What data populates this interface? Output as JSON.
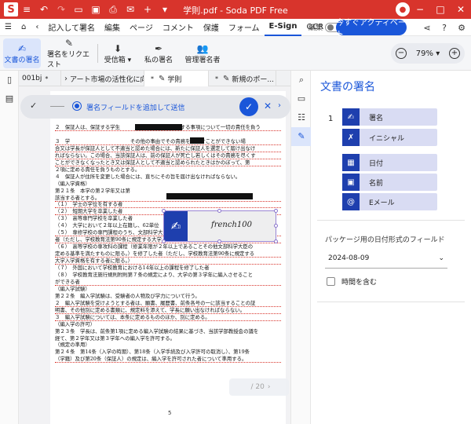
{
  "app": {
    "file_title": "学則.pdf",
    "app_name": "Soda PDF Free",
    "title_sep": "-"
  },
  "menu": {
    "items": [
      "記入して署名",
      "編集",
      "ページ",
      "コメント",
      "保護",
      "フォーム",
      "E-Sign",
      "OCR"
    ],
    "active": "E-Sign",
    "edit_toggle_label": "編集",
    "activate_label": "今すぐアクティベート"
  },
  "ribbon": {
    "buttons": [
      "文書の署名",
      "署名をリクエスト",
      "受信箱",
      "私の署名",
      "管理署名者"
    ],
    "zoom": "79%"
  },
  "tabs": [
    {
      "label": "001bj",
      "icon": "file-icon",
      "modified": true
    },
    {
      "label": "アート市場の活性化に向けて",
      "icon": "file-icon",
      "modified": true
    },
    {
      "label": "学則",
      "icon": "pen-icon",
      "modified": true
    },
    {
      "label": "新規のポー...",
      "icon": "pen-icon",
      "modified": false
    }
  ],
  "signbar": {
    "status": "署名フィールドを追加して送信"
  },
  "signature_field": {
    "signer_name": "french100"
  },
  "document": {
    "lines": [
      {
        "text": "２　保証人は、保証する学生　　　　　　　　　務に関する事項について一切の責任を負う",
        "u": true
      },
      {
        "text": "",
        "u": false
      },
      {
        "text": "３　学　　　　　　　　　　　　その他の事由でその責務を尽くすことができない場",
        "u": true
      },
      {
        "text": "合又は学長が保証人として不適当と認めた場合には、新たに保証人を選定して届け出なけ",
        "u": true
      },
      {
        "text": "ればならない。この場合、当該保証人は、前の保証人が死亡し若しくはその責務を尽くす",
        "u": true
      },
      {
        "text": "ことができなくなったとき又は保証人として不適当と認められたときはかのぼって、第",
        "u": true
      },
      {
        "text": "２項に定める責任を負うものとする。",
        "u": false
      },
      {
        "text": "４　保証人が住所を変更した場合には、直ちにその旨を届け出なければならない。",
        "u": false
      },
      {
        "text": "（編入学資格）",
        "u": false
      },
      {
        "text": "第２１条　本学の第２学年又は第",
        "u": false
      },
      {
        "text": "該当する者とする。",
        "u": true
      },
      {
        "text": "（１）　学士の学位を有する者",
        "u": true
      },
      {
        "text": "（２）　短期大学を卒業した者",
        "u": true
      },
      {
        "text": "（３）　高等専門学校を卒業した者",
        "u": false
      },
      {
        "text": "（４）　大学において２年以上在籍し、62単位",
        "u": false
      },
      {
        "text": "（５）　専修学校の専門課程のうち、文部科学大臣の定める基準を満たすものを修了した",
        "u": true
      },
      {
        "text": "者（ただし、学校教育法第90条に規定する大学入学資格を有する者に限る。）",
        "u": true
      },
      {
        "text": "（６）　高等学校の専攻科の課程（修業年限が２年以上であることその他文部科学大臣の",
        "u": false
      },
      {
        "text": "定める基準を満たすものに限る。）を修了した者（ただし、学校教育法第90条に規定する",
        "u": true
      },
      {
        "text": "大学入学資格を有する者に限る。）",
        "u": true
      },
      {
        "text": "（７）　外国において学校教育における14年以上の課程を修了した者",
        "u": false
      },
      {
        "text": "（８）　学校教育法施行規則附則第７条の規定により、大学の第３学年に編入させること",
        "u": false
      },
      {
        "text": "ができる者",
        "u": true
      },
      {
        "text": "（編入学試験）",
        "u": false
      },
      {
        "text": "第２２条　編入学試験は、受験者の人物及び学力について行う。",
        "u": false
      },
      {
        "text": "２　編入学試験を受けようとする者は、願書、履歴書、前条各号の一に該当することの証",
        "u": true
      },
      {
        "text": "明書、その他別に定める書類に、規定料を添えて、学長に願い出なければならない。",
        "u": true
      },
      {
        "text": "３　編入学試験については、本条に定めるもののほか、別に定める。",
        "u": true
      },
      {
        "text": "（編入学の許可）",
        "u": false
      },
      {
        "text": "第２３条　学長は、前条第1項に定める編入学試験の結果に基づき、当該学部教授会の議を",
        "u": false
      },
      {
        "text": "経て、第２学年又は第３学年への編入学を許可する。",
        "u": false
      },
      {
        "text": "（規定の準用）",
        "u": false
      },
      {
        "text": "第２４条　第14条（入学の時期）、第18条（入学手続及び入学許可の取消し）、第19条",
        "u": false
      },
      {
        "text": "（学籍）及び第20条（保証人）の規定は、編入学を許可された者について準用する。",
        "u": true
      }
    ],
    "page_number": "5"
  },
  "pager": {
    "current": "",
    "total": "/ 20"
  },
  "panel": {
    "title": "文書の署名",
    "signer_index": "1",
    "field_buttons": [
      {
        "label": "署名",
        "icon": "signature-icon"
      },
      {
        "label": "イニシャル",
        "icon": "initials-icon"
      },
      {
        "label": "日付",
        "icon": "calendar-icon"
      },
      {
        "label": "名前",
        "icon": "person-card-icon"
      },
      {
        "label": "Eメール",
        "icon": "at-icon"
      }
    ],
    "date_format_label": "パッケージ用の日付形式のフィールド",
    "date_value": "2024-08-09",
    "include_time_label": "時間を含む"
  },
  "colors": {
    "brand": "#d8342c",
    "accent": "#1a56d9",
    "field_icon_bg": "#1e3fae",
    "field_btn_bg": "#d9dcf3"
  }
}
